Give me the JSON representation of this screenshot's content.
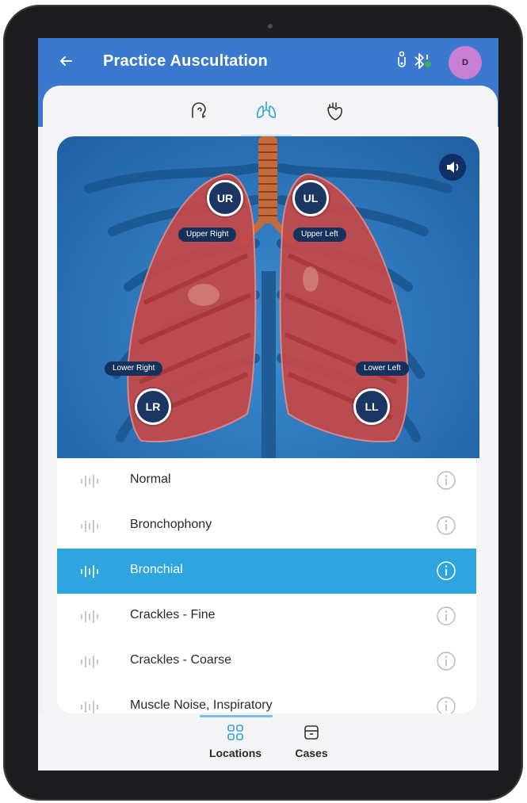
{
  "appbar": {
    "title": "Practice Auscultation",
    "back_icon": "arrow-left-icon",
    "stethoscope_icon": "stethoscope-icon",
    "bluetooth_icon": "bluetooth-connected-icon",
    "avatar_initial": "D"
  },
  "modes": [
    {
      "icon": "head-ear-icon",
      "active": false
    },
    {
      "icon": "lungs-icon",
      "active": true
    },
    {
      "icon": "heart-icon",
      "active": false
    }
  ],
  "locations": {
    "ur": {
      "short": "UR",
      "label": "Upper Right"
    },
    "ul": {
      "short": "UL",
      "label": "Upper Left"
    },
    "lr": {
      "short": "LR",
      "label": "Lower Right"
    },
    "ll": {
      "short": "LL",
      "label": "Lower Left"
    }
  },
  "sounds": [
    {
      "label": "Normal",
      "selected": false
    },
    {
      "label": "Bronchophony",
      "selected": false
    },
    {
      "label": "Bronchial",
      "selected": true
    },
    {
      "label": "Crackles - Fine",
      "selected": false
    },
    {
      "label": "Crackles - Coarse",
      "selected": false
    },
    {
      "label": "Muscle Noise, Inspiratory",
      "selected": false
    }
  ],
  "bottom_nav": {
    "locations": "Locations",
    "cases": "Cases"
  },
  "colors": {
    "appbar": "#3b79cf",
    "selected_row": "#2fa5e0",
    "marker": "#1c3664",
    "avatar": "#c97fd4"
  }
}
